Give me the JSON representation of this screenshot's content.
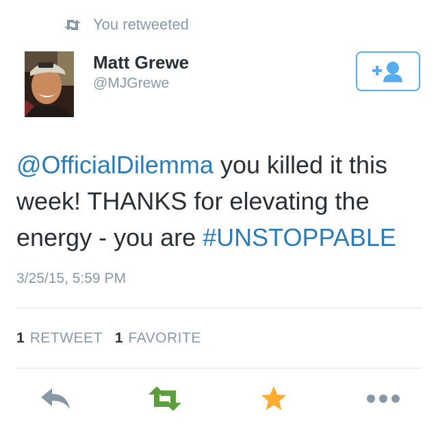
{
  "context": {
    "label": "You retweeted",
    "icon": "retweet-icon"
  },
  "author": {
    "name": "Matt Grewe",
    "handle": "@MJGrewe",
    "avatar": "avatar-photo"
  },
  "follow_button": {
    "icon": "add-user-icon",
    "color": "#55acee"
  },
  "tweet": {
    "mention": "@OfficialDilemma",
    "text_middle": " you killed it this week! THANKS for elevating the energy - you are ",
    "hashtag": "#UNSTOPPABLE",
    "link_color": "#2b7bb9"
  },
  "timestamp": "3/25/15, 5:59 PM",
  "stats": {
    "retweet_count": "1",
    "retweet_label": "RETWEET",
    "favorite_count": "1",
    "favorite_label": "FAVORITE"
  },
  "actions": {
    "reply": {
      "icon": "reply-icon",
      "color": "#8899a6"
    },
    "retweet": {
      "icon": "retweet-icon",
      "color": "#5c9e3c",
      "active": true
    },
    "favorite": {
      "icon": "star-icon",
      "color": "#ffac33",
      "active": true
    },
    "more": {
      "icon": "more-icon",
      "color": "#8899a6"
    }
  }
}
